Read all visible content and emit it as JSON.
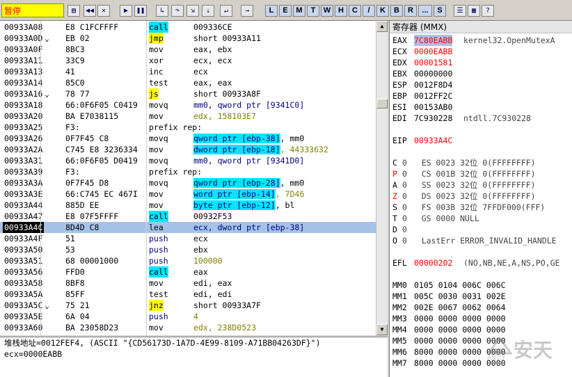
{
  "status": "暂停",
  "toolbar_letters": [
    "L",
    "E",
    "M",
    "T",
    "W",
    "H",
    "C",
    "/",
    "K",
    "B",
    "R",
    "...",
    "S"
  ],
  "toolbar_icons": [
    "open-icon",
    "rewind-icon",
    "close-icon",
    "run-icon",
    "pause-icon",
    "step-into-icon",
    "step-over-icon",
    "trace-into-icon",
    "trace-over-icon",
    "execute-till-return-icon",
    "go-to-icon",
    "list-icon",
    "grid-icon",
    "help-icon"
  ],
  "disasm": [
    {
      "addr": "00933A08",
      "mark": "",
      "hex": "E8 C1FCFFFF",
      "mn": "call",
      "mnStyle": "call",
      "op": "009336CE",
      "opStyle": "plain"
    },
    {
      "addr": "00933A0D",
      "mark": "⌄",
      "hex": "EB 02",
      "mn": "jmp",
      "mnStyle": "jmp",
      "op": "short 00933A11",
      "opStyle": "plain"
    },
    {
      "addr": "00933A0F",
      "mark": "",
      "hex": "8BC3",
      "mn": "mov",
      "mnStyle": "plain",
      "op": "eax, ebx",
      "opStyle": "plain"
    },
    {
      "addr": "00933A11",
      "mark": "",
      "hex": "33C9",
      "mn": "xor",
      "mnStyle": "plain",
      "op": "ecx, ecx",
      "opStyle": "plain"
    },
    {
      "addr": "00933A13",
      "mark": "",
      "hex": "41",
      "mn": "inc",
      "mnStyle": "plain",
      "op": "ecx",
      "opStyle": "plain"
    },
    {
      "addr": "00933A14",
      "mark": "",
      "hex": "85C0",
      "mn": "test",
      "mnStyle": "plain",
      "op": "eax, eax",
      "opStyle": "plain"
    },
    {
      "addr": "00933A16",
      "mark": "⌄",
      "hex": "78 77",
      "mn": "js",
      "mnStyle": "jmp",
      "op": "short 00933A8F",
      "opStyle": "plain"
    },
    {
      "addr": "00933A18",
      "mark": "",
      "hex": "66:0F6F05 C0419",
      "mn": "movq",
      "mnStyle": "plain",
      "op": "mm0, qword ptr [9341C0]",
      "opStyle": "blue"
    },
    {
      "addr": "00933A20",
      "mark": "",
      "hex": "BA E7038115",
      "mn": "mov",
      "mnStyle": "plain",
      "op": "edx, 158103E7",
      "opStyle": "num"
    },
    {
      "addr": "00933A25",
      "mark": "",
      "hex": "F3:",
      "mn": "prefix rep:",
      "mnStyle": "plain",
      "op": "",
      "opStyle": "plain"
    },
    {
      "addr": "00933A26",
      "mark": "",
      "hex": "0F7F45 C8",
      "mn": "movq",
      "mnStyle": "plain",
      "op": "qword ptr [ebp-38], mm0",
      "opStyle": "mem"
    },
    {
      "addr": "00933A2A",
      "mark": "",
      "hex": "C745 E8 3236334",
      "mn": "mov",
      "mnStyle": "plain",
      "op": "dword ptr [ebp-18], 44333632",
      "opStyle": "memnum"
    },
    {
      "addr": "00933A31",
      "mark": "",
      "hex": "66:0F6F05 D0419",
      "mn": "movq",
      "mnStyle": "plain",
      "op": "mm0, qword ptr [9341D0]",
      "opStyle": "blue"
    },
    {
      "addr": "00933A39",
      "mark": "",
      "hex": "F3:",
      "mn": "prefix rep:",
      "mnStyle": "plain",
      "op": "",
      "opStyle": "plain"
    },
    {
      "addr": "00933A3A",
      "mark": "",
      "hex": "0F7F45 D8",
      "mn": "movq",
      "mnStyle": "plain",
      "op": "qword ptr [ebp-28], mm0",
      "opStyle": "mem"
    },
    {
      "addr": "00933A3E",
      "mark": "",
      "hex": "66:C745 EC 467I",
      "mn": "mov",
      "mnStyle": "plain",
      "op": "word ptr [ebp-14], 7D46",
      "opStyle": "memnum"
    },
    {
      "addr": "00933A44",
      "mark": "",
      "hex": "885D EE",
      "mn": "mov",
      "mnStyle": "plain",
      "op": "byte ptr [ebp-12], bl",
      "opStyle": "mem"
    },
    {
      "addr": "00933A47",
      "mark": "",
      "hex": "E8 07F5FFFF",
      "mn": "call",
      "mnStyle": "call",
      "op": "00932F53",
      "opStyle": "plain"
    },
    {
      "addr": "00933A4C",
      "mark": "",
      "hex": "8D4D C8",
      "mn": "lea",
      "mnStyle": "plain",
      "op": "ecx, dword ptr [ebp-38]",
      "opStyle": "memsel",
      "selected": true
    },
    {
      "addr": "00933A4F",
      "mark": "",
      "hex": "51",
      "mn": "push",
      "mnStyle": "blue",
      "op": "ecx",
      "opStyle": "plain"
    },
    {
      "addr": "00933A50",
      "mark": "",
      "hex": "53",
      "mn": "push",
      "mnStyle": "blue",
      "op": "ebx",
      "opStyle": "plain"
    },
    {
      "addr": "00933A51",
      "mark": "",
      "hex": "68 00001000",
      "mn": "push",
      "mnStyle": "blue",
      "op": "100000",
      "opStyle": "num"
    },
    {
      "addr": "00933A56",
      "mark": "",
      "hex": "FFD0",
      "mn": "call",
      "mnStyle": "call",
      "op": "eax",
      "opStyle": "plain"
    },
    {
      "addr": "00933A58",
      "mark": "",
      "hex": "8BF8",
      "mn": "mov",
      "mnStyle": "plain",
      "op": "edi, eax",
      "opStyle": "plain"
    },
    {
      "addr": "00933A5A",
      "mark": "",
      "hex": "85FF",
      "mn": "test",
      "mnStyle": "plain",
      "op": "edi, edi",
      "opStyle": "plain"
    },
    {
      "addr": "00933A5C",
      "mark": "⌄",
      "hex": "75 21",
      "mn": "jnz",
      "mnStyle": "jmp",
      "op": "short 00933A7F",
      "opStyle": "plain"
    },
    {
      "addr": "00933A5E",
      "mark": "",
      "hex": "6A 04",
      "mn": "push",
      "mnStyle": "blue",
      "op": "4",
      "opStyle": "num"
    },
    {
      "addr": "00933A60",
      "mark": "",
      "hex": "BA 23058D23",
      "mn": "mov",
      "mnStyle": "plain",
      "op": "edx, 238D0523",
      "opStyle": "num"
    }
  ],
  "info_lines": [
    "堆栈地址=0012FEF4, (ASCII \"{CD56173D-1A7D-4E99-8109-A71BB04263DF}\")",
    "ecx=0000EABB"
  ],
  "registers": {
    "title": "寄存器 (MMX)",
    "lines": [
      {
        "name": "EAX",
        "value": "7C80EABB",
        "comment": "kernel32.OpenMutexA",
        "style": "sel"
      },
      {
        "name": "ECX",
        "value": "0000EABB",
        "comment": "",
        "style": "red"
      },
      {
        "name": "EDX",
        "value": "00001581",
        "comment": "",
        "style": "red"
      },
      {
        "name": "EBX",
        "value": "00000000",
        "comment": "",
        "style": "plain"
      },
      {
        "name": "ESP",
        "value": "0012F8D4",
        "comment": "",
        "style": "plain"
      },
      {
        "name": "EBP",
        "value": "0012FF2C",
        "comment": "",
        "style": "plain"
      },
      {
        "name": "ESI",
        "value": "00153AB0",
        "comment": "",
        "style": "plain"
      },
      {
        "name": "EDI",
        "value": "7C930228",
        "comment": "ntdll.7C930228",
        "style": "plain"
      },
      {
        "name": "",
        "value": "",
        "comment": "",
        "style": "blank"
      },
      {
        "name": "EIP",
        "value": "00933A4C",
        "comment": "",
        "style": "red"
      },
      {
        "name": "",
        "value": "",
        "comment": "",
        "style": "blank"
      },
      {
        "name": "C",
        "value": "0   ES 0023 32位 0(FFFFFFFF)",
        "comment": "",
        "style": "flag"
      },
      {
        "name": "P",
        "value": "0   CS 001B 32位 0(FFFFFFFF)",
        "comment": "",
        "style": "flagred"
      },
      {
        "name": "A",
        "value": "0   SS 0023 32位 0(FFFFFFFF)",
        "comment": "",
        "style": "flag"
      },
      {
        "name": "Z",
        "value": "0   DS 0023 32位 0(FFFFFFFF)",
        "comment": "",
        "style": "flagred"
      },
      {
        "name": "S",
        "value": "0   FS 003B 32位 7FFDF000(FFF)",
        "comment": "",
        "style": "flag"
      },
      {
        "name": "T",
        "value": "0   GS 0000 NULL",
        "comment": "",
        "style": "flag"
      },
      {
        "name": "D",
        "value": "0",
        "comment": "",
        "style": "flag"
      },
      {
        "name": "O",
        "value": "0   LastErr ERROR_INVALID_HANDLE",
        "comment": "",
        "style": "flag"
      },
      {
        "name": "",
        "value": "",
        "comment": "",
        "style": "blank"
      },
      {
        "name": "EFL",
        "value": "00000202",
        "comment": "(NO,NB,NE,A,NS,PO,GE",
        "style": "red"
      },
      {
        "name": "",
        "value": "",
        "comment": "",
        "style": "blank"
      },
      {
        "name": "MM0",
        "value": "0105 0104 006C 006C",
        "comment": "",
        "style": "plain"
      },
      {
        "name": "MM1",
        "value": "005C 0030 0031 002E",
        "comment": "",
        "style": "plain"
      },
      {
        "name": "MM2",
        "value": "002E 0067 0062 0064",
        "comment": "",
        "style": "plain"
      },
      {
        "name": "MM3",
        "value": "0000 0000 0000 0000",
        "comment": "",
        "style": "plain"
      },
      {
        "name": "MM4",
        "value": "0000 0000 0000 0000",
        "comment": "",
        "style": "plain"
      },
      {
        "name": "MM5",
        "value": "0000 0000 0000 0000",
        "comment": "",
        "style": "plain"
      },
      {
        "name": "MM6",
        "value": "8000 0000 0000 0000",
        "comment": "",
        "style": "plain"
      },
      {
        "name": "MM7",
        "value": "8000 0000 0000 0000",
        "comment": "",
        "style": "plain"
      }
    ]
  },
  "watermark": {
    "text": "安天",
    "sub": "ANTIY"
  }
}
